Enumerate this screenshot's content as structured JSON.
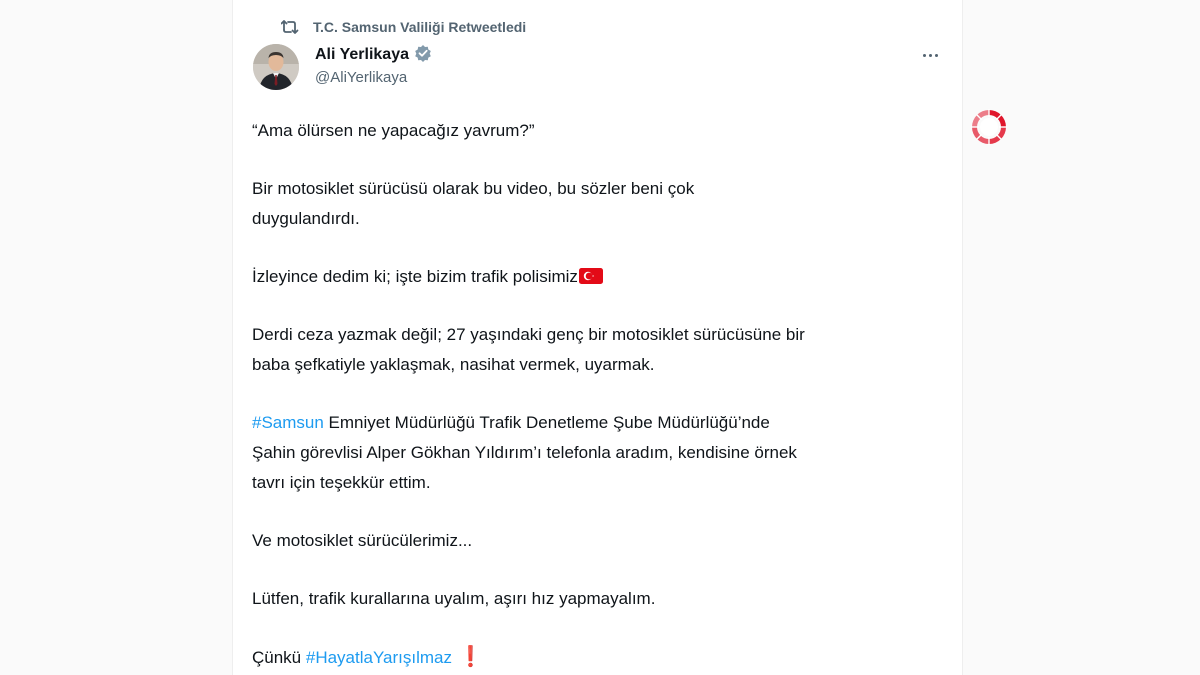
{
  "retweet": {
    "label": "T.C. Samsun Valiliği Retweetledi",
    "icon": "retweet-icon"
  },
  "author": {
    "name": "Ali Yerlikaya",
    "handle": "@AliYerlikaya",
    "verified_icon": "verified-badge-icon",
    "verified_color": "#829aab"
  },
  "menu": {
    "icon": "more-options-icon"
  },
  "tweet": {
    "p1": "“Ama ölürsen ne yapacağız yavrum?”",
    "p2_line1": "Bir motosiklet sürücüsü olarak bu video, bu sözler beni çok",
    "p2_line2": "duygulandırdı.",
    "p3_text": "İzleyince dedim ki; işte bizim trafik polisimiz",
    "p3_flag": "turkey-flag-icon",
    "p4_line1": "Derdi ceza yazmak değil; 27 yaşındaki genç bir motosiklet sürücüsüne bir",
    "p4_line2": "baba şefkatiyle yaklaşmak, nasihat vermek, uyarmak.",
    "p5_hashtag": "#Samsun",
    "p5_line1_rest": " Emniyet Müdürlüğü Trafik Denetleme Şube Müdürlüğü’nde",
    "p5_line2": "Şahin görevlisi Alper Gökhan Yıldırım’ı telefonla aradım, kendisine örnek",
    "p5_line3": "tavrı için teşekkür ettim.",
    "p6": "Ve motosiklet sürücülerimiz...",
    "p7": "Lütfen, trafik kurallarına uyalım, aşırı hız yapmayalım.",
    "p8_prefix": "Çünkü ",
    "p8_hashtag": "#HayatlaYarışılmaz",
    "p8_suffix": "❗"
  },
  "colors": {
    "hashtag": "#1d9bf0",
    "text": "#0f1419",
    "muted": "#536471",
    "logo_red": "#e0162b"
  },
  "watermark": {
    "icon": "news-agency-logo-icon"
  }
}
